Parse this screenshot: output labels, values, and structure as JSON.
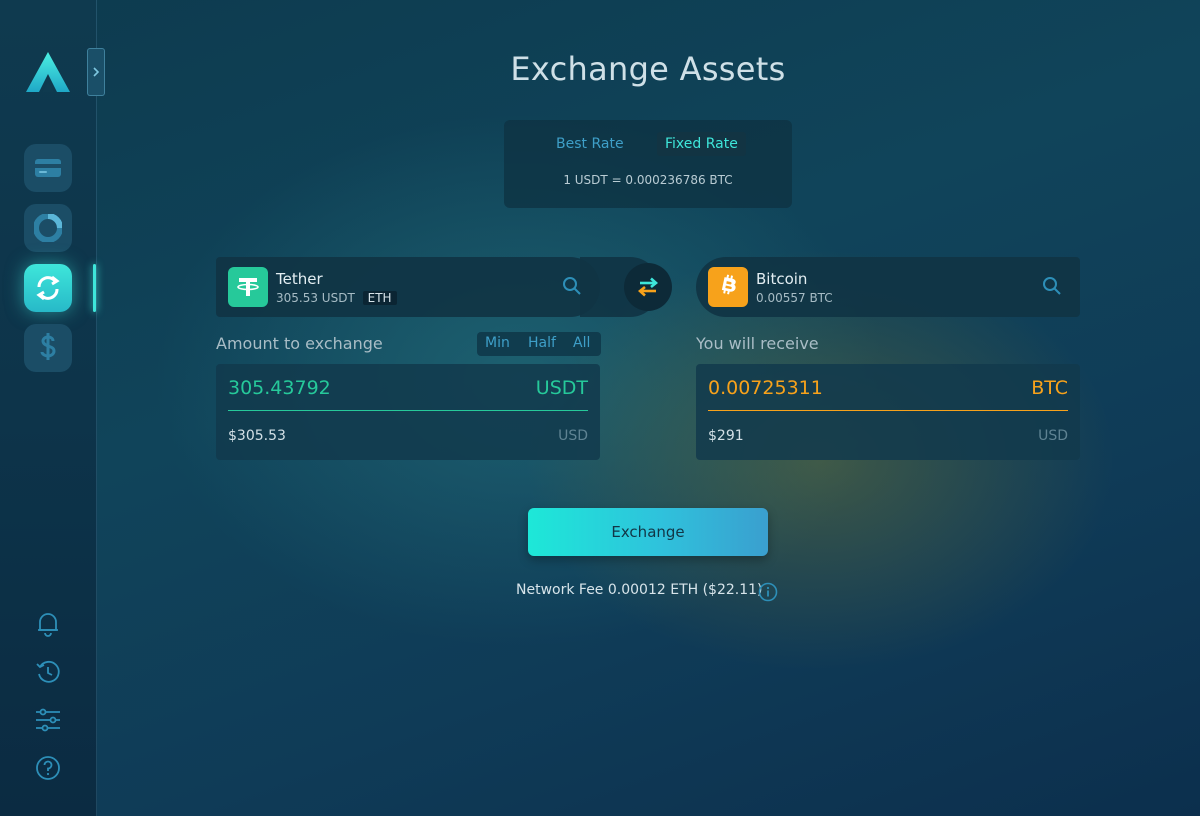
{
  "page": {
    "title": "Exchange Assets"
  },
  "sidebar": {
    "nav": [
      {
        "name": "wallet",
        "icon": "wallet-icon"
      },
      {
        "name": "portfolio",
        "icon": "pie-chart-icon"
      },
      {
        "name": "exchange",
        "icon": "sync-icon",
        "active": true
      },
      {
        "name": "buy",
        "icon": "dollar-icon"
      }
    ],
    "bottom": [
      {
        "name": "notifications",
        "icon": "bell-icon"
      },
      {
        "name": "history",
        "icon": "history-icon"
      },
      {
        "name": "settings",
        "icon": "sliders-icon"
      },
      {
        "name": "help",
        "icon": "help-icon"
      }
    ]
  },
  "rate": {
    "tabs": [
      "Best Rate",
      "Fixed Rate"
    ],
    "selected": "Fixed Rate",
    "text": "1 USDT = 0.000236786 BTC"
  },
  "from": {
    "name": "Tether",
    "balance": "305.53 USDT",
    "chain": "ETH",
    "label": "Amount to exchange",
    "amount": "305.43792",
    "unit": "USDT",
    "usd_value": "$305.53",
    "usd_unit": "USD",
    "quick": [
      "Min",
      "Half",
      "All"
    ]
  },
  "to": {
    "name": "Bitcoin",
    "balance": "0.00557 BTC",
    "label": "You will receive",
    "amount": "0.00725311",
    "unit": "BTC",
    "usd_value": "$291",
    "usd_unit": "USD"
  },
  "action": {
    "button": "Exchange",
    "fee_label": "Network Fee",
    "fee_value": "0.00012 ETH ($22.11)"
  },
  "colors": {
    "accent": "#3ee6da",
    "tether": "#26c99a",
    "bitcoin": "#f7a21b"
  }
}
